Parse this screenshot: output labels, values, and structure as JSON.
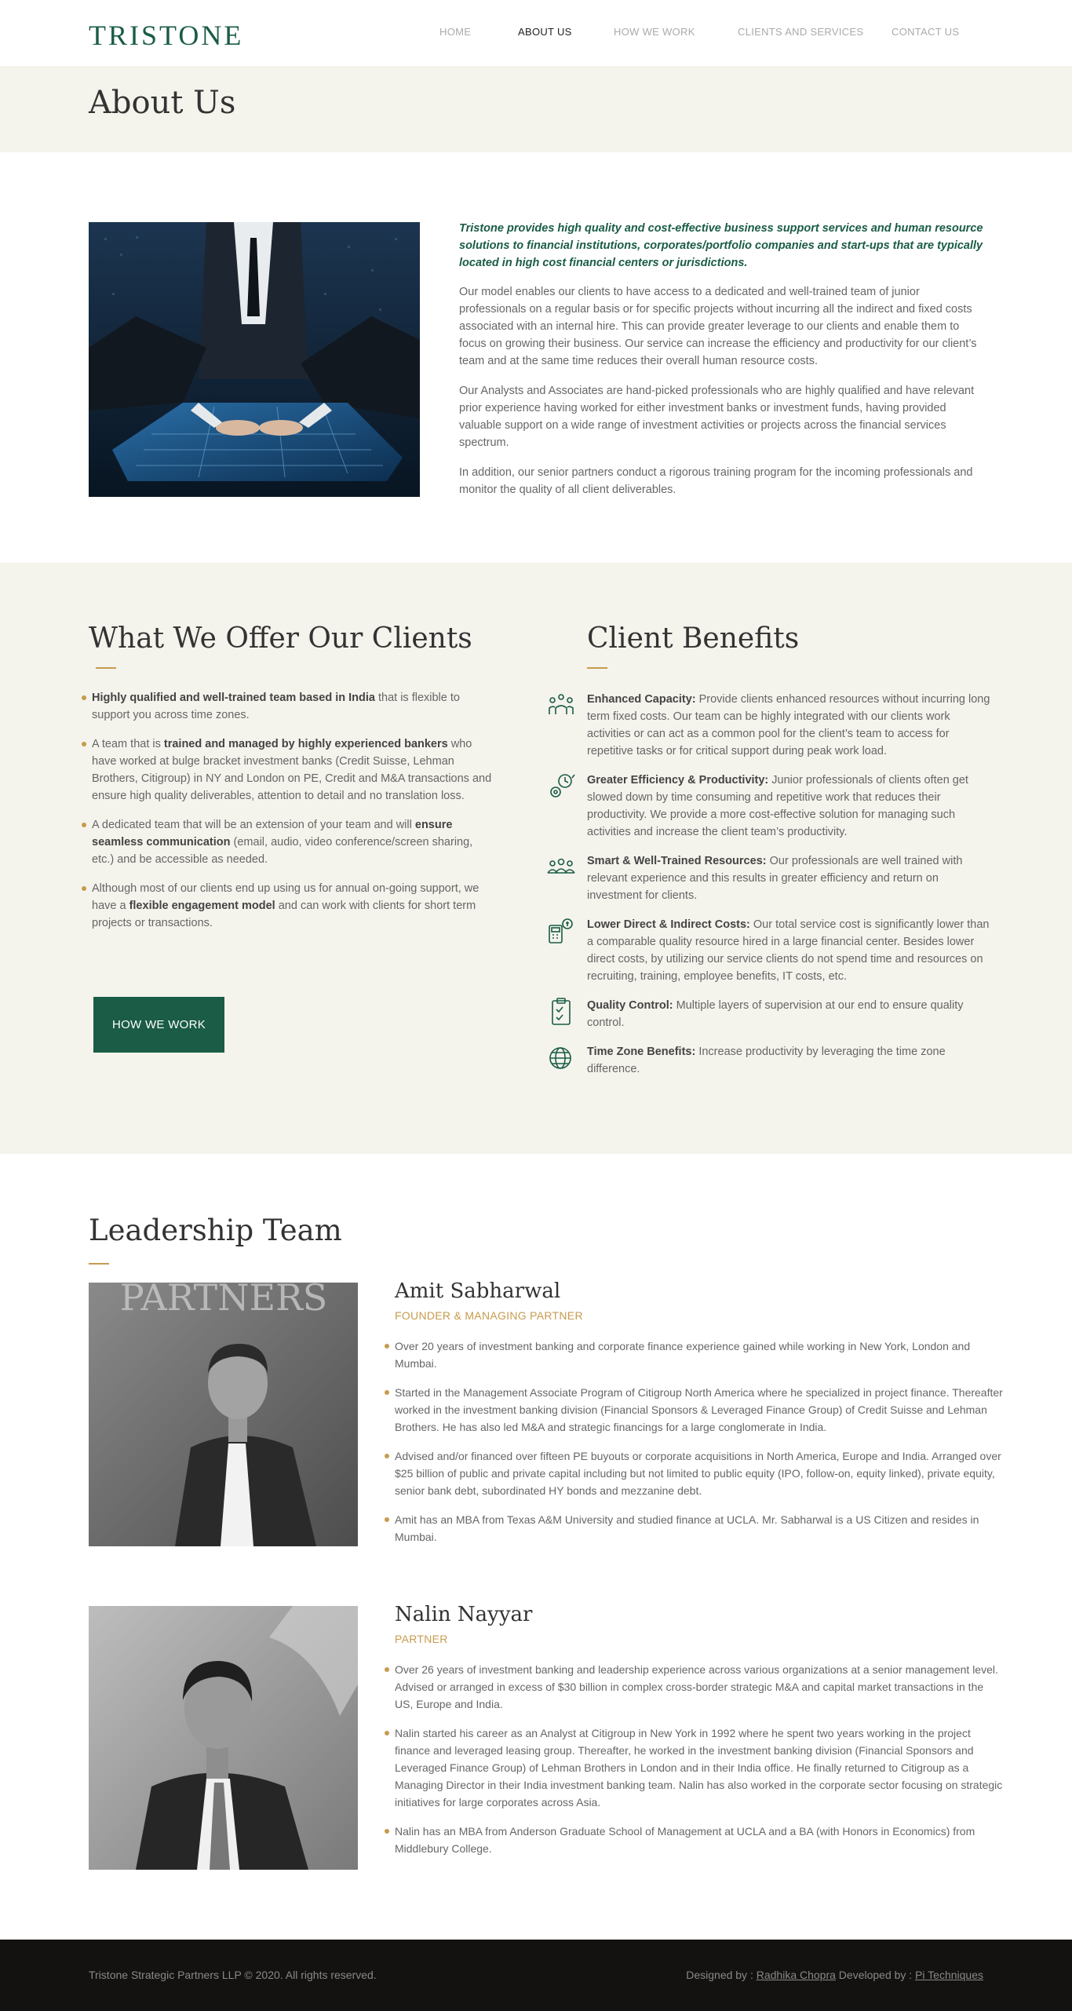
{
  "header": {
    "logo": "TRISTONE",
    "nav": [
      "HOME",
      "ABOUT US",
      "HOW WE WORK",
      "CLIENTS AND SERVICES",
      "CONTACT US"
    ],
    "active_nav": "ABOUT US"
  },
  "page_title": "About Us",
  "about": {
    "lead": "Tristone provides high quality and cost-effective business support services and human resource solutions to financial institutions, corporates/portfolio companies and start-ups that are typically located in high cost financial centers or jurisdictions.",
    "paragraphs": [
      "Our model enables our clients to have access to a dedicated and well-trained team of junior professionals on a regular basis or for specific projects without incurring all the indirect and fixed costs associated with an internal hire. This can provide greater leverage to our clients and enable them to focus on growing their business. Our service can increase the efficiency and productivity for our client’s team and at the same time reduces their overall human resource costs.",
      "Our Analysts and Associates are hand-picked professionals who are highly qualified and have relevant prior experience having worked for either investment banks or investment funds, having provided valuable support on a wide range of investment activities or projects across the financial services spectrum.",
      "In addition, our senior partners conduct a rigorous training program for the incoming professionals and monitor the quality of all client deliverables."
    ]
  },
  "offer": {
    "title": "What We Offer Our Clients",
    "items": [
      {
        "strong": "Highly qualified and well-trained team based in India",
        "rest": " that is flexible to support you across time zones."
      },
      {
        "pre": "A team that is ",
        "strong": "trained and managed by highly experienced bankers",
        "rest": " who have worked at bulge bracket investment banks (Credit Suisse, Lehman Brothers, Citigroup) in NY and London on PE, Credit and M&A transactions and ensure high quality deliverables, attention to detail and no translation loss."
      },
      {
        "pre": "A dedicated team that will be an extension of your team and will ",
        "strong": "ensure seamless communication",
        "rest": " (email, audio, video conference/screen sharing, etc.) and be accessible as needed."
      },
      {
        "pre": "Although most of our clients end up using us for annual on-going support, we have a ",
        "strong": "flexible engagement model",
        "rest": " and can work with clients for short term projects or transactions."
      }
    ],
    "button": "HOW WE WORK"
  },
  "benefits": {
    "title": "Client Benefits",
    "items": [
      {
        "icon": "capacity-icon",
        "strong": "Enhanced Capacity:",
        "rest": " Provide clients enhanced resources without incurring long term fixed costs. Our team can be highly integrated with our clients work activities or can act as a common pool for the client’s team to access for repetitive tasks or for critical support during peak work load."
      },
      {
        "icon": "efficiency-icon",
        "strong": "Greater Efficiency & Productivity:",
        "rest": " Junior professionals of clients often get slowed down by time consuming and repetitive work that reduces their productivity. We provide a more cost-effective solution for managing such activities and increase the client team’s productivity."
      },
      {
        "icon": "team-icon",
        "strong": "Smart & Well-Trained Resources:",
        "rest": " Our professionals are well trained with relevant experience and this results in greater efficiency and return on investment for clients."
      },
      {
        "icon": "cost-icon",
        "strong": "Lower Direct & Indirect Costs:",
        "rest": " Our total service cost is significantly lower than a comparable quality resource hired in a large financial center. Besides lower direct costs, by utilizing our service clients do not spend time and resources on recruiting, training, employee benefits, IT costs, etc."
      },
      {
        "icon": "quality-icon",
        "strong": "Quality Control:",
        "rest": " Multiple layers of supervision at our end to ensure quality control."
      },
      {
        "icon": "globe-icon",
        "strong": "Time Zone Benefits:",
        "rest": " Increase productivity by leveraging the time zone difference."
      }
    ]
  },
  "leadership": {
    "title": "Leadership Team",
    "members": [
      {
        "name": "Amit Sabharwal",
        "role": "FOUNDER & MANAGING PARTNER",
        "photo_sign": "PARTNERS",
        "points": [
          "Over 20 years of investment banking and corporate finance experience gained while working in New York, London and Mumbai.",
          "Started in the Management Associate Program of Citigroup North America where he specialized in project finance. Thereafter worked in the investment banking division (Financial Sponsors & Leveraged Finance Group) of Credit Suisse and Lehman Brothers. He has also led M&A and strategic financings for a large conglomerate in India.",
          "Advised and/or financed over fifteen PE buyouts or corporate acquisitions in North America, Europe and India. Arranged over $25 billion of public and private capital including but not limited to public equity (IPO, follow-on, equity linked), private equity, senior bank debt, subordinated HY bonds and mezzanine debt.",
          "Amit has an MBA from Texas A&M University and studied finance at UCLA. Mr. Sabharwal is a US Citizen and resides in Mumbai."
        ]
      },
      {
        "name": "Nalin Nayyar",
        "role": "PARTNER",
        "points": [
          "Over 26 years of investment banking and leadership experience across various organizations at a senior management level. Advised or arranged in excess of $30 billion in complex cross-border strategic M&A and capital market transactions in the US, Europe and India.",
          "Nalin started his career as an Analyst at Citigroup in New York in 1992 where he spent two years working in the project finance and leveraged leasing group. Thereafter, he worked in the investment banking division (Financial Sponsors and Leveraged Finance Group) of Lehman Brothers in London and in their India office. He finally returned to Citigroup as a Managing Director in their India investment banking team. Nalin has also worked in the corporate sector focusing on strategic initiatives for large corporates across Asia.",
          "Nalin has an MBA from Anderson Graduate School of Management at UCLA and a BA (with Honors in Economics) from Middlebury College."
        ]
      }
    ]
  },
  "footer": {
    "copyright": "Tristone Strategic Partners LLP © 2020. All rights reserved.",
    "designed_by_label": "Designed by : ",
    "designer": "Radhika Chopra",
    "developed_by_label": " Developed by : ",
    "developer": "Pi Techniques"
  },
  "colors": {
    "brand_green": "#1a5c46",
    "accent_gold": "#c79b4e",
    "band_beige": "#f4f3ec",
    "footer_bg": "#141211"
  }
}
